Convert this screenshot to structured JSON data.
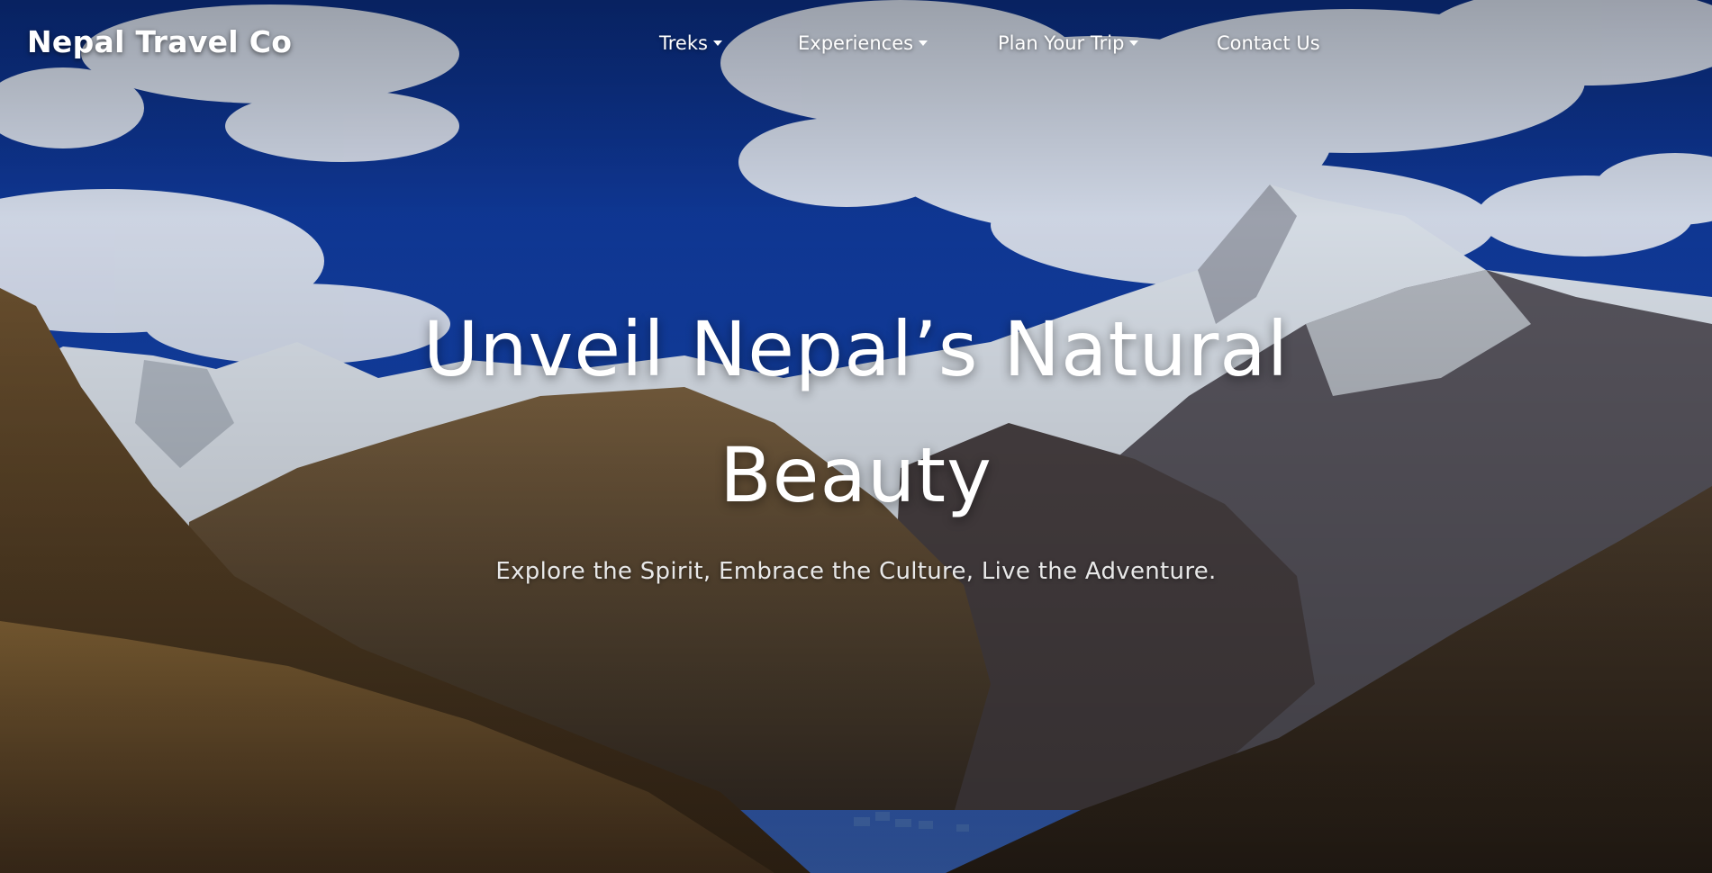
{
  "brand": {
    "name": "Nepal Travel Co"
  },
  "nav": {
    "items": [
      {
        "label": "Treks",
        "has_dropdown": true
      },
      {
        "label": "Experiences",
        "has_dropdown": true
      },
      {
        "label": "Plan Your Trip",
        "has_dropdown": true
      },
      {
        "label": "Contact Us",
        "has_dropdown": false
      }
    ]
  },
  "hero": {
    "title": "Unveil Nepal’s Natural Beauty",
    "subtitle": "Explore the Spirit, Embrace the Culture, Live the Adventure.",
    "background_image": "mountain-valley-photo"
  },
  "colors": {
    "sky": "#0f3a98",
    "text": "#ffffff",
    "subtitle": "#e8e8e8",
    "slope": "#7a5a2e",
    "rock": "#3d3a3c",
    "snow": "#e6ecf3"
  }
}
